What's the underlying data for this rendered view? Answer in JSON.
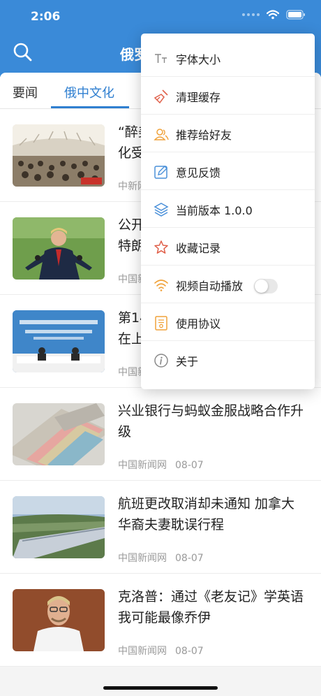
{
  "status": {
    "time": "2:06"
  },
  "header": {
    "title": "俄罗"
  },
  "tabs": [
    {
      "label": "要闻",
      "active": false
    },
    {
      "label": "俄中文化",
      "active": true
    }
  ],
  "menu": {
    "items": [
      {
        "label": "字体大小",
        "icon": "font-size-icon"
      },
      {
        "label": "清理缓存",
        "icon": "broom-icon"
      },
      {
        "label": "推荐给好友",
        "icon": "users-icon"
      },
      {
        "label": "意见反馈",
        "icon": "edit-icon"
      },
      {
        "label": "当前版本  1.0.0",
        "icon": "layers-icon"
      },
      {
        "label": "收藏记录",
        "icon": "star-icon"
      },
      {
        "label": "视频自动播放",
        "icon": "wifi-icon",
        "toggle": false
      },
      {
        "label": "使用协议",
        "icon": "document-icon"
      },
      {
        "label": "关于",
        "icon": "info-icon"
      }
    ]
  },
  "articles": [
    {
      "title": "“醉美",
      "title_line2": "化受",
      "source": "中新网",
      "date": ""
    },
    {
      "title": "公开",
      "title_line2": "特朗",
      "source": "中国新",
      "date": ""
    },
    {
      "title": "第14",
      "title_line2": "在上",
      "source": "中国新",
      "date": ""
    },
    {
      "title": "兴业银行与蚂蚁金服战略合作升级",
      "source": "中国新闻网",
      "date": "08-07"
    },
    {
      "title": "航班更改取消却未通知 加拿大华裔夫妻耽误行程",
      "source": "中国新闻网",
      "date": "08-07"
    },
    {
      "title": "克洛普：通过《老友记》学英语 我可能最像乔伊",
      "source": "中国新闻网",
      "date": "08-07"
    }
  ],
  "colors": {
    "header": "#3a8ad8",
    "accent": "#2f7fd0",
    "menu_icon_orange": "#f0a23a",
    "menu_icon_blue": "#4a90d9"
  }
}
